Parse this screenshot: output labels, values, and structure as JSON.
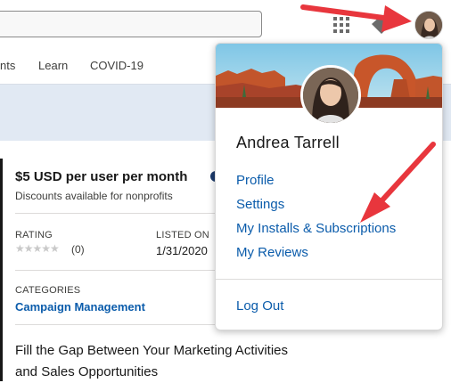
{
  "nav": {
    "items": [
      "nts",
      "Learn",
      "COVID-19"
    ]
  },
  "listing": {
    "price": "$5 USD per user per month",
    "discount": "Discounts available for nonprofits",
    "rating_label": "RATING",
    "rating_count": "(0)",
    "listed_label": "LISTED ON",
    "listed_date": "1/31/2020",
    "categories_label": "CATEGORIES",
    "category": "Campaign Management",
    "headline": "Fill the Gap Between Your Marketing Activities and Sales Opportunities"
  },
  "user_menu": {
    "name": "Andrea Tarrell",
    "items": [
      "Profile",
      "Settings",
      "My Installs & Subscriptions",
      "My Reviews"
    ],
    "logout": "Log Out"
  },
  "colors": {
    "link": "#0b5cab",
    "accent_band": "#e1e9f3",
    "annotation_arrow": "#e8363d"
  },
  "icons": [
    "apps-grid-icon",
    "tag-icon",
    "avatar",
    "info-icon",
    "star-icon",
    "annotation-arrow"
  ]
}
